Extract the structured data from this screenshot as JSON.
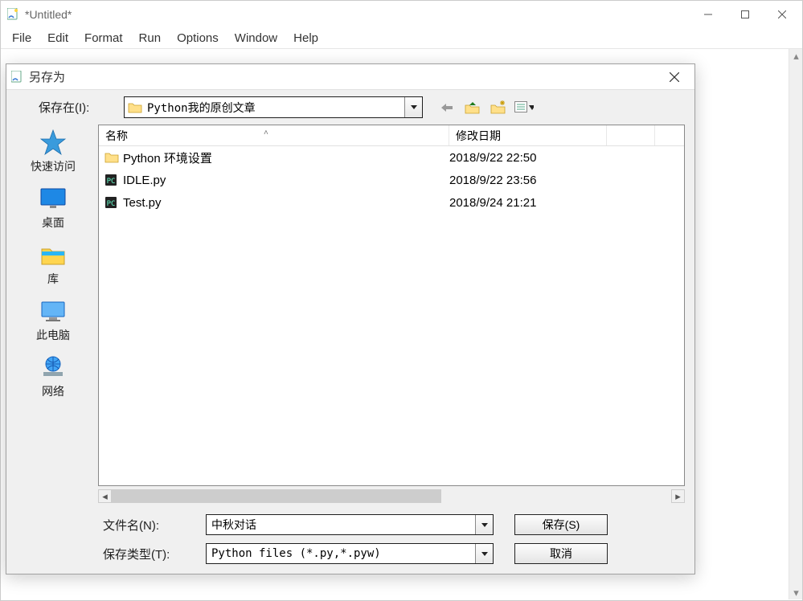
{
  "main_window": {
    "title": "*Untitled*"
  },
  "menubar": {
    "items": [
      "File",
      "Edit",
      "Format",
      "Run",
      "Options",
      "Window",
      "Help"
    ]
  },
  "dialog": {
    "title": "另存为",
    "save_in_label": "保存在(I):",
    "save_in_value": "Python我的原创文章",
    "sidebar": {
      "items": [
        {
          "label": "快速访问"
        },
        {
          "label": "桌面"
        },
        {
          "label": "库"
        },
        {
          "label": "此电脑"
        },
        {
          "label": "网络"
        }
      ]
    },
    "columns": {
      "name": "名称",
      "date": "修改日期"
    },
    "rows": [
      {
        "name": "Python 环境设置",
        "date": "2018/9/22 22:50",
        "type": "folder"
      },
      {
        "name": "IDLE.py",
        "date": "2018/9/22 23:56",
        "type": "pyfile"
      },
      {
        "name": "Test.py",
        "date": "2018/9/24 21:21",
        "type": "pyfile"
      }
    ],
    "filename_label": "文件名(N):",
    "filename_value": "中秋对话",
    "filetype_label": "保存类型(T):",
    "filetype_value": "Python files (*.py,*.pyw)",
    "save_btn": "保存(S)",
    "cancel_btn": "取消"
  }
}
